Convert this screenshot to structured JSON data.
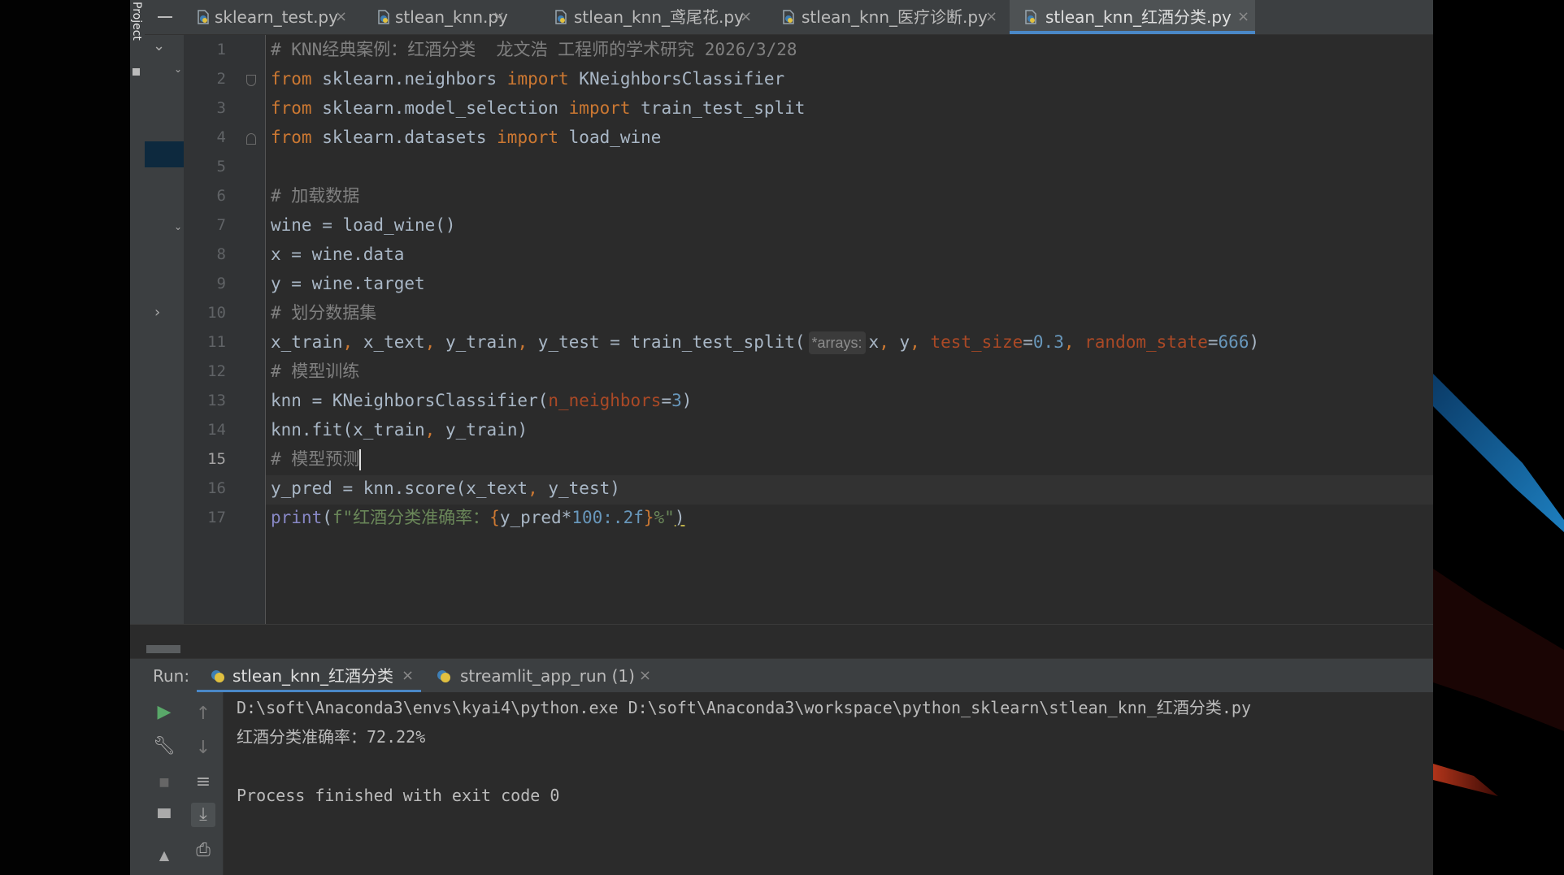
{
  "sidebar": {
    "project_label": "Project"
  },
  "tabs": [
    {
      "label": "sklearn_test.py",
      "active": false
    },
    {
      "label": "stlean_knn.py",
      "active": false
    },
    {
      "label": "stlean_knn_鸢尾花.py",
      "active": false
    },
    {
      "label": "stlean_knn_医疗诊断.py",
      "active": false
    },
    {
      "label": "stlean_knn_红酒分类.py",
      "active": true
    }
  ],
  "editor": {
    "current_line": 15,
    "line_numbers": [
      "1",
      "2",
      "3",
      "4",
      "5",
      "6",
      "7",
      "8",
      "9",
      "10",
      "11",
      "12",
      "13",
      "14",
      "15",
      "16",
      "17"
    ],
    "lines": {
      "l1": "# KNN经典案例：红酒分类  龙文浩 工程师的学术研究 2026/3/28",
      "l2": {
        "kw1": "from",
        "mod": " sklearn.neighbors ",
        "kw2": "import",
        "name": " KNeighborsClassifier"
      },
      "l3": {
        "kw1": "from",
        "mod": " sklearn.model_selection ",
        "kw2": "import",
        "name": " train_test_split"
      },
      "l4": {
        "kw1": "from",
        "mod": " sklearn.datasets ",
        "kw2": "import",
        "name": " load_wine"
      },
      "l6": "# 加载数据",
      "l7": "wine = load_wine()",
      "l8": "x = wine.data",
      "l9": "y = wine.target",
      "l10": "# 划分数据集",
      "l11": {
        "a": "x_train",
        "c1": ",",
        "b": " x_text",
        "c2": ",",
        "c": " y_train",
        "c3": ",",
        "d": " y_test = train_test_split(",
        "hint": "*arrays:",
        "e": "x",
        "c4": ",",
        "f": " y",
        "c5": ",",
        "p1": " test_size",
        "eq1": "=",
        "n1": "0.3",
        "c6": ",",
        "p2": " random_state",
        "eq2": "=",
        "n2": "666",
        "end": ")"
      },
      "l12": "# 模型训练",
      "l13": {
        "a": "knn = KNeighborsClassifier(",
        "p": "n_neighbors",
        "eq": "=",
        "n": "3",
        "end": ")"
      },
      "l14": {
        "a": "knn.fit(x_train",
        "c": ",",
        "b": " y_train)"
      },
      "l15": "# 模型预测",
      "l16": {
        "a": "y_pred = knn.score(x_text",
        "c": ",",
        "b": " y_test)"
      },
      "l17": {
        "fn": "print",
        "open": "(",
        "s1": "f\"红酒分类准确率：",
        "br1": "{",
        "expr": "y_pred*",
        "num": "100",
        "fmt": ":.2f",
        "br2": "}",
        "s2": "%\"",
        "close": ")"
      }
    }
  },
  "run": {
    "title": "Run:",
    "tabs": [
      {
        "label": "stlean_knn_红酒分类",
        "active": true
      },
      {
        "label": "streamlit_app_run (1)",
        "active": false
      }
    ],
    "console": [
      "D:\\soft\\Anaconda3\\envs\\kyai4\\python.exe D:\\soft\\Anaconda3\\workspace\\python_sklearn\\stlean_knn_红酒分类.py",
      "红酒分类准确率：72.22%",
      "",
      "Process finished with exit code 0"
    ]
  },
  "colors": {
    "keyword": "#cc7832",
    "comment": "#808080",
    "number": "#6897bb",
    "param": "#aa4926",
    "string": "#6a8759",
    "builtin": "#8888c6",
    "accent": "#4a88c7"
  }
}
